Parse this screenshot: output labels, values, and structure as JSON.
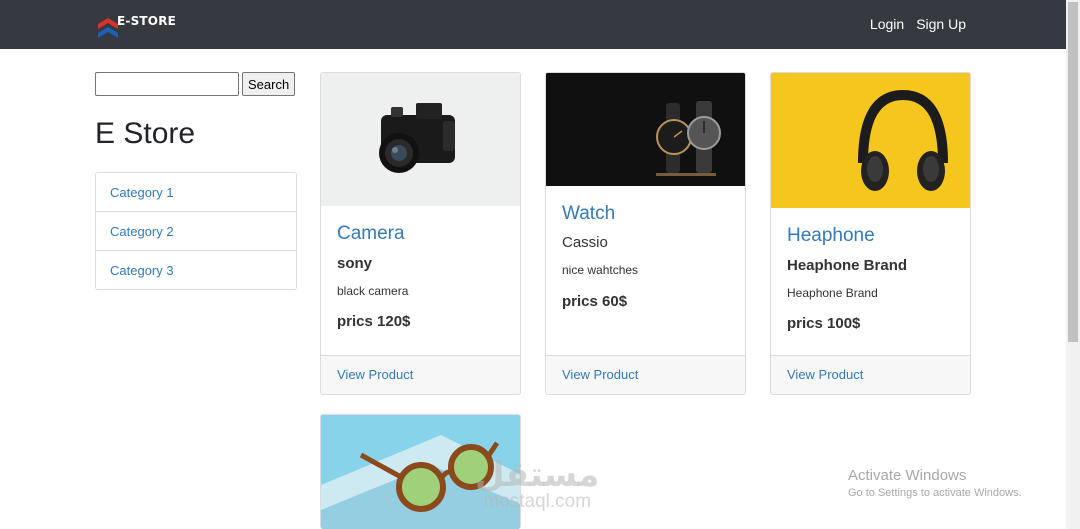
{
  "navbar": {
    "brand": "E-STORE",
    "brand_colors": [
      "#d9322b",
      "#1f5fb5"
    ],
    "links": [
      "Login",
      "Sign Up"
    ]
  },
  "sidebar": {
    "search_button": "Search",
    "search_value": "",
    "title": "E Store",
    "categories": [
      "Category 1",
      "Category 2",
      "Category 3"
    ]
  },
  "products": [
    {
      "title": "Camera",
      "brand": "sony",
      "description": "black camera",
      "price": "prics 120$",
      "link": "View Product",
      "image": "camera-photo"
    },
    {
      "title": "Watch",
      "brand": "Cassio",
      "description": "nice wahtches",
      "price": "prics 60$",
      "link": "View Product",
      "image": "watch-photo"
    },
    {
      "title": "Heaphone",
      "brand": "Heaphone Brand",
      "description": "Heaphone Brand",
      "price": "prics 100$",
      "link": "View Product",
      "image": "headphone-photo"
    },
    {
      "image": "glasses-photo"
    }
  ],
  "watermark": {
    "line1": "Activate Windows",
    "line2": "Go to Settings to activate Windows.",
    "site_ar": "مستقل",
    "site_en": "mostaql.com"
  }
}
